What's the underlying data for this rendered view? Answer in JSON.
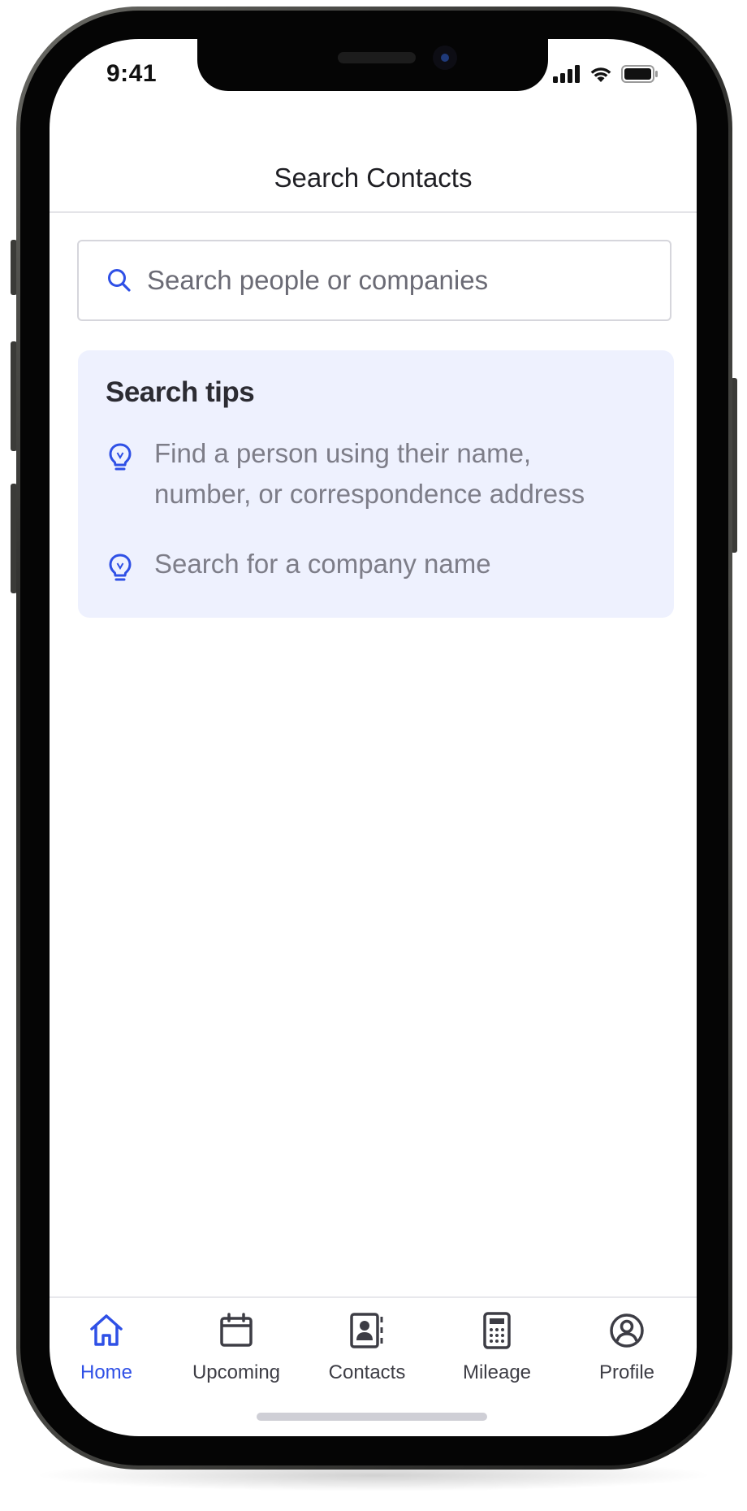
{
  "status_bar": {
    "time": "9:41"
  },
  "header": {
    "title": "Search Contacts"
  },
  "search": {
    "placeholder": "Search people or companies",
    "value": ""
  },
  "tips": {
    "title": "Search tips",
    "items": [
      "Find a person using their name, number, or correspondence address",
      "Search for a company name"
    ]
  },
  "tabbar": {
    "items": [
      {
        "label": "Home",
        "icon": "home-icon",
        "active": true
      },
      {
        "label": "Upcoming",
        "icon": "calendar-icon",
        "active": false
      },
      {
        "label": "Contacts",
        "icon": "contact-book-icon",
        "active": false
      },
      {
        "label": "Mileage",
        "icon": "calculator-icon",
        "active": false
      },
      {
        "label": "Profile",
        "icon": "user-circle-icon",
        "active": false
      }
    ]
  },
  "colors": {
    "accent": "#2f50e6",
    "tips_background": "#eef1fe",
    "text_primary": "#1f1f24",
    "text_muted": "#7d7d88"
  }
}
